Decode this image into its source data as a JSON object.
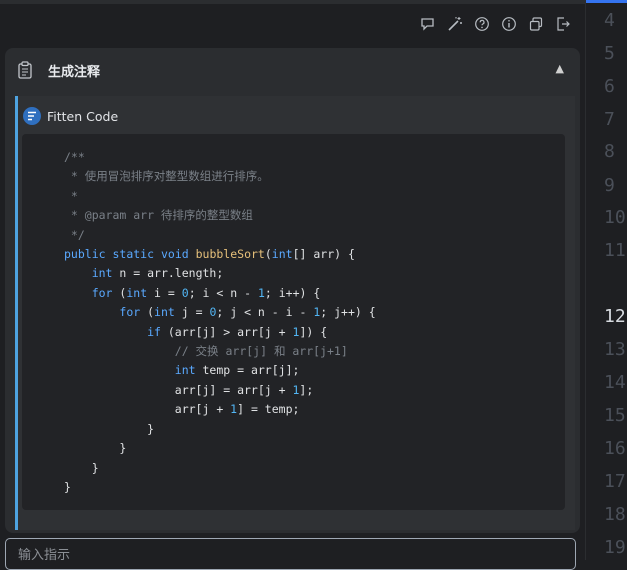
{
  "toolbar": {
    "icons": [
      "chat-bubble-icon",
      "magic-wand-icon",
      "help-icon",
      "info-icon",
      "copy-icon",
      "exit-icon"
    ]
  },
  "panel": {
    "title": "生成注释",
    "collapse_symbol": "▲"
  },
  "message": {
    "author": "Fitten Code",
    "code_lines": [
      "/**",
      " * 使用冒泡排序对整型数组进行排序。",
      " *",
      " * @param arr 待排序的整型数组",
      " */",
      "public static void bubbleSort(int[] arr) {",
      "    int n = arr.length;",
      "    for (int i = 0; i < n - 1; i++) {",
      "        for (int j = 0; j < n - i - 1; j++) {",
      "            if (arr[j] > arr[j + 1]) {",
      "                // 交换 arr[j] 和 arr[j+1]",
      "                int temp = arr[j];",
      "                arr[j] = arr[j + 1];",
      "                arr[j + 1] = temp;",
      "            }",
      "        }",
      "    }",
      "}"
    ]
  },
  "input": {
    "placeholder": "输入指示"
  },
  "editor_gutter": {
    "line_numbers": [
      "4",
      "5",
      "6",
      "7",
      "8",
      "9",
      "10",
      "11",
      "12",
      "13",
      "14",
      "15",
      "16",
      "17",
      "18",
      "19"
    ],
    "current_line": "12"
  },
  "colors": {
    "accent": "#3574f0",
    "message_bar": "#4ea3e0",
    "keyword": "#5aa9ff",
    "function": "#e6c07b"
  }
}
